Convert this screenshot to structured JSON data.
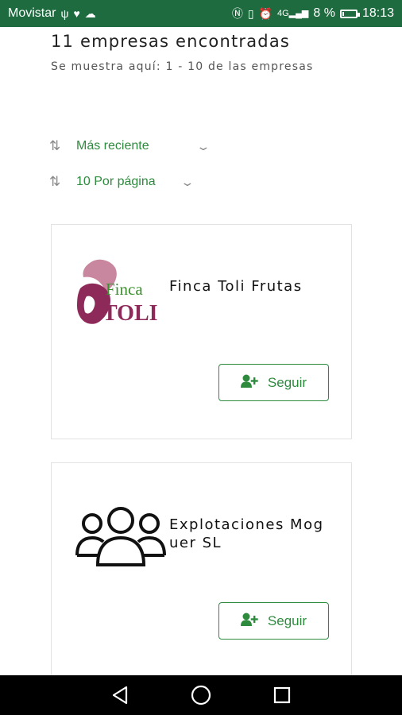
{
  "status_bar": {
    "carrier": "Movistar",
    "battery_text": "8 %",
    "battery_level": 0.08,
    "signal_text": "4G",
    "time": "18:13",
    "icons": [
      "usb-icon",
      "heart-monitor-icon",
      "cloud-icon",
      "nfc-icon",
      "vibrate-icon",
      "alarm-icon",
      "signal-icon",
      "battery-icon"
    ]
  },
  "results": {
    "title": "11 empresas encontradas",
    "subtitle": "Se muestra aquí: 1 - 10 de las empresas"
  },
  "controls": {
    "sort": {
      "label": "Más reciente",
      "icon": "sort-icon"
    },
    "per_page": {
      "label": "10 Por página",
      "icon": "sort-icon"
    }
  },
  "companies": [
    {
      "name": "Finca Toli Frutas",
      "logo": "finca-toli-logo",
      "logo_text_top": "Finca",
      "logo_text_bottom": "TOLI",
      "follow_label": "Seguir"
    },
    {
      "name": "Explotaciones Moguer SL",
      "logo": "group-placeholder-icon",
      "follow_label": "Seguir"
    }
  ],
  "colors": {
    "status_bar": "#1e6b3f",
    "accent_green": "#2e8b3e",
    "logo_purple": "#8e2a5a",
    "logo_green": "#3c8f2f"
  },
  "nav": [
    "back-icon",
    "home-icon",
    "recents-icon"
  ]
}
